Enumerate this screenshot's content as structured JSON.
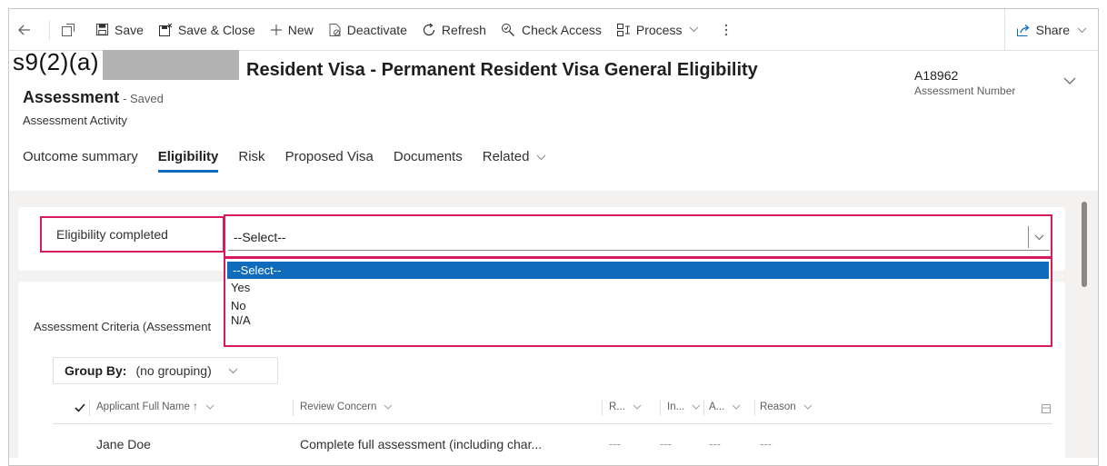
{
  "toolbar": {
    "save": "Save",
    "save_close": "Save & Close",
    "new": "New",
    "deactivate": "Deactivate",
    "refresh": "Refresh",
    "check_access": "Check Access",
    "process": "Process",
    "share": "Share"
  },
  "header": {
    "redaction_label": "s9(2)(a)",
    "visa_title": "Resident Visa - Permanent Resident Visa General Eligibility",
    "entity": "Assessment",
    "status": "- Saved",
    "subtitle": "Assessment Activity",
    "assessment_number": "A18962",
    "assessment_number_label": "Assessment Number"
  },
  "tabs": [
    {
      "label": "Outcome summary"
    },
    {
      "label": "Eligibility"
    },
    {
      "label": "Risk"
    },
    {
      "label": "Proposed Visa"
    },
    {
      "label": "Documents"
    },
    {
      "label": "Related"
    }
  ],
  "eligibility": {
    "label": "Eligibility completed",
    "selected": "--Select--",
    "options": [
      "--Select--",
      "Yes",
      "No",
      "N/A"
    ]
  },
  "criteria": {
    "section_label": "Assessment Criteria (Assessment",
    "group_by_label": "Group By:",
    "group_by_value": "(no grouping)",
    "columns": [
      "Applicant Full Name ↑",
      "Review Concern",
      "R...",
      "In...",
      "A...",
      "Reason"
    ],
    "rows": [
      {
        "name": "Jane Doe",
        "concern": "Complete full assessment (including char...",
        "c1": "---",
        "c2": "---",
        "c3": "---",
        "c4": "---"
      }
    ]
  }
}
